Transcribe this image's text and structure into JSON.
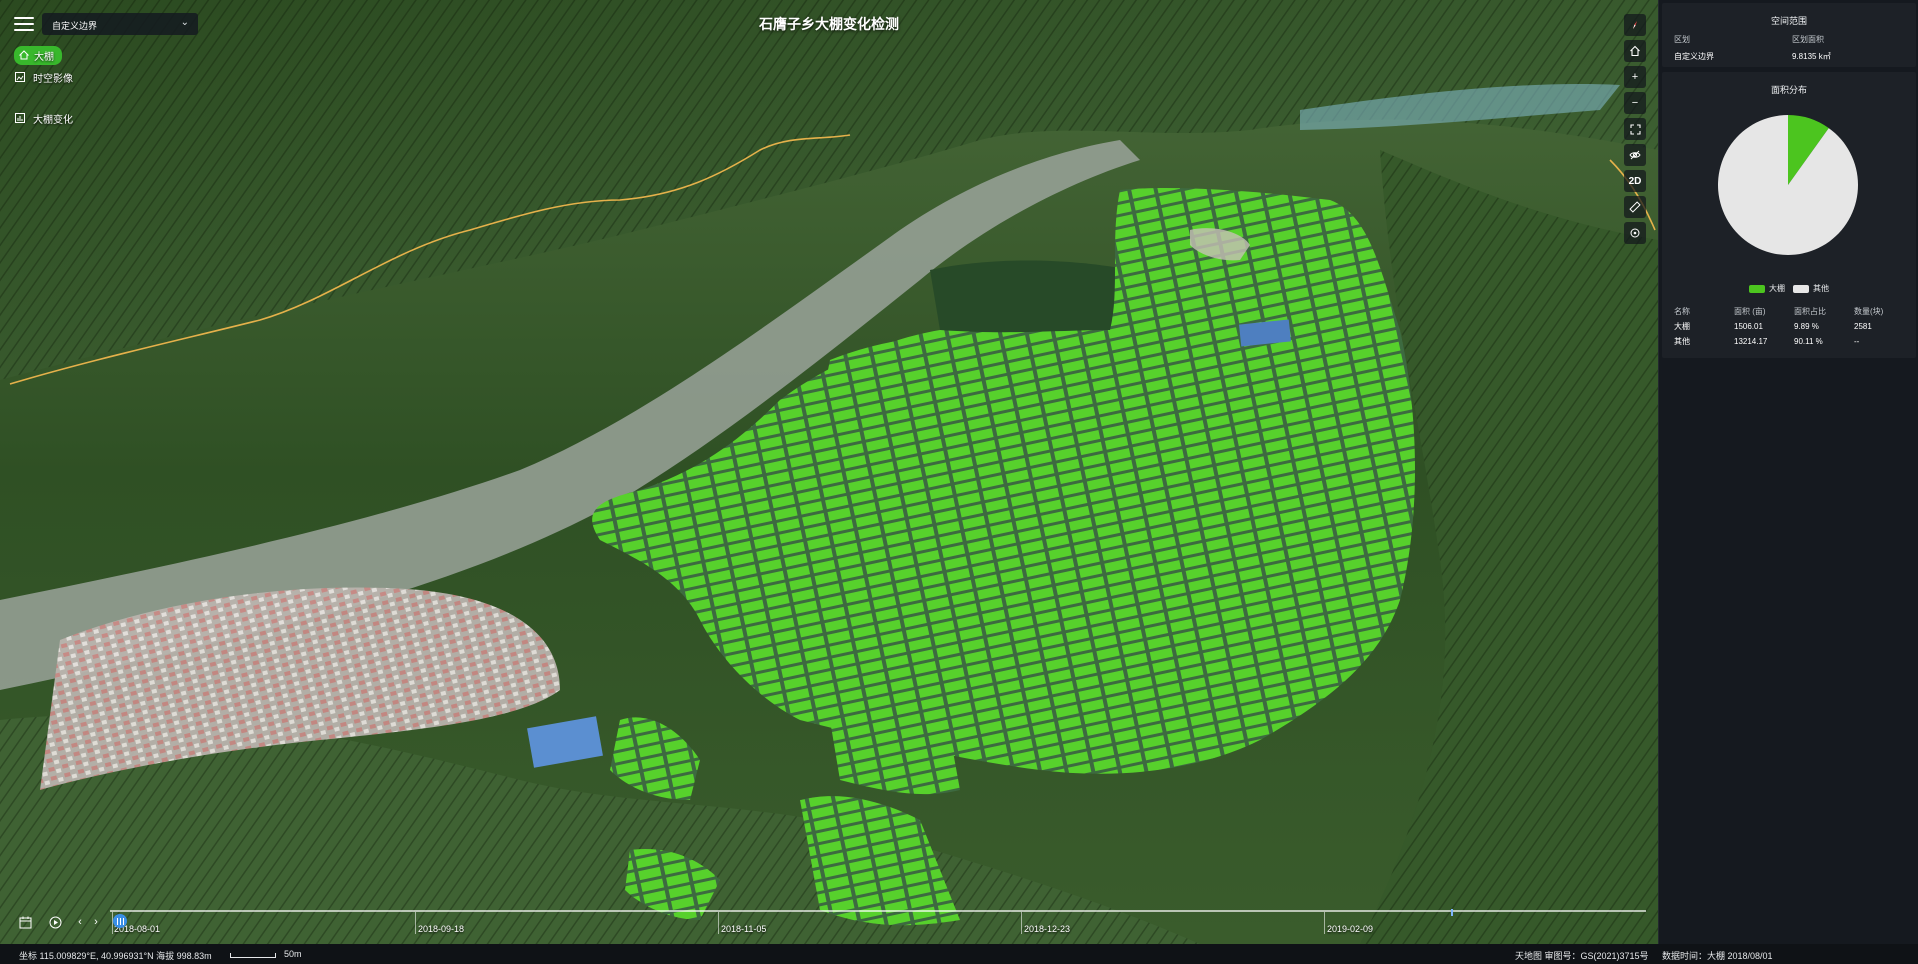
{
  "map": {
    "title": "石膺子乡大棚变化检测",
    "boundary_select": "自定义边界",
    "layers": [
      {
        "label": "大棚",
        "active": true,
        "icon": "home-icon"
      },
      {
        "label": "时空影像",
        "active": false,
        "icon": "image-icon"
      },
      {
        "label": "大棚变化",
        "active": false,
        "icon": "chart-icon"
      }
    ],
    "tools": {
      "compass": "compass-icon",
      "home": "home-icon",
      "zoom_in": "+",
      "zoom_out": "−",
      "fullscreen": "fullscreen-icon",
      "hide": "eye-off-icon",
      "mode": "2D",
      "measure": "ruler-icon",
      "locate": "locate-icon"
    },
    "accent_green": "#4cc51f",
    "accent_blue": "#3a8fe6"
  },
  "timeline": {
    "labels": [
      "2018-08-01",
      "2018-09-18",
      "2018-11-05",
      "2018-12-23",
      "2019-02-09"
    ]
  },
  "status": {
    "coords": "坐标 115.009829°E, 40.996931°N  海拔 998.83m",
    "scale": "50m",
    "credit": "天地图 审图号：GS(2021)3715号",
    "data_time": "数据时间：大棚 2018/08/01"
  },
  "panel": {
    "space": {
      "title": "空间范围",
      "col1_header": "区划",
      "col2_header": "区划面积",
      "col1_value": "自定义边界",
      "col2_value": "9.8135 k㎡"
    },
    "area": {
      "title": "面积分布",
      "legend": [
        {
          "label": "大棚",
          "color": "#4cc51f"
        },
        {
          "label": "其他",
          "color": "#e6e6e6"
        }
      ],
      "headers": [
        "名称",
        "面积 (亩)",
        "面积占比",
        "数量(块)"
      ],
      "rows": [
        [
          "大棚",
          "1506.01",
          "9.89 %",
          "2581"
        ],
        [
          "其他",
          "13214.17",
          "90.11 %",
          "--"
        ]
      ]
    }
  },
  "chart_data": {
    "type": "pie",
    "labels": [
      "大棚",
      "其他"
    ],
    "values": [
      9.89,
      90.11
    ],
    "colors": [
      "#4cc51f",
      "#e6e6e6"
    ]
  }
}
